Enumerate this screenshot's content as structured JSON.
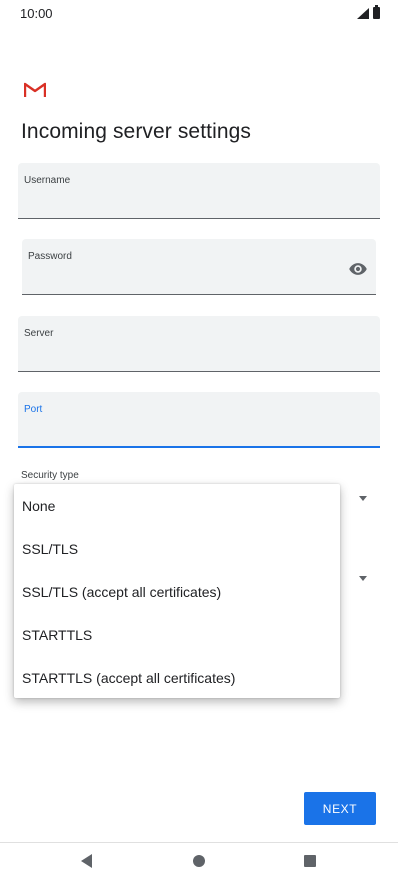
{
  "status_bar": {
    "time": "10:00",
    "signal_icon": "signal-icon",
    "battery_icon": "battery-icon"
  },
  "app": {
    "logo_icon": "gmail-logo",
    "accent_color": "#1a73e8",
    "logo_color": "#d93025"
  },
  "page": {
    "title": "Incoming server settings"
  },
  "fields": {
    "username": {
      "label": "Username",
      "value": ""
    },
    "password": {
      "label": "Password",
      "value": "",
      "toggle_icon": "eye-icon"
    },
    "server": {
      "label": "Server",
      "value": ""
    },
    "port": {
      "label": "Port",
      "value": "",
      "focused": true
    }
  },
  "security": {
    "label": "Security type",
    "options": [
      "None",
      "SSL/TLS",
      "SSL/TLS (accept all certificates)",
      "STARTTLS",
      "STARTTLS (accept all certificates)"
    ]
  },
  "actions": {
    "next_label": "NEXT"
  },
  "nav_bar": {
    "back_icon": "back-icon",
    "home_icon": "home-icon",
    "recents_icon": "recents-icon"
  }
}
